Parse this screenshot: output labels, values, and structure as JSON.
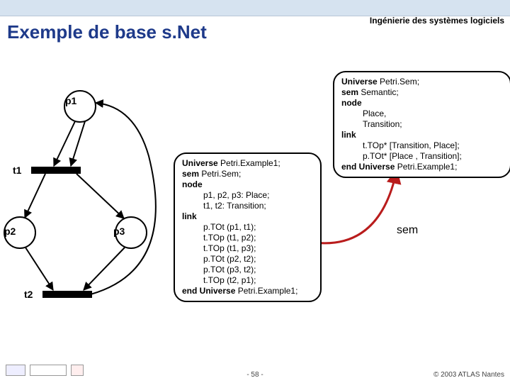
{
  "header": {
    "subject": "Ingénierie des systèmes logiciels",
    "title": "Exemple de base s.Net"
  },
  "petri": {
    "places": {
      "p1": "p1",
      "p2": "p2",
      "p3": "p3"
    },
    "transitions": {
      "t1": "t1",
      "t2": "t2"
    }
  },
  "code_example": {
    "l1_kw": "Universe",
    "l1_rest": " Petri.Example1;",
    "l2_kw": "sem",
    "l2_rest": " Petri.Sem;",
    "l3_kw": "node",
    "l4": "p1, p2, p3: Place;",
    "l5": "t1, t2: Transition;",
    "l6_kw": "link",
    "l7": "p.TOt (p1, t1);",
    "l8": "t.TOp (t1, p2);",
    "l9": "t.TOp (t1, p3);",
    "l10": "p.TOt (p2, t2);",
    "l11": "p.TOt (p3, t2);",
    "l12": "t.TOp (t2, p1);",
    "l13_kw": "end Universe",
    "l13_rest": " Petri.Example1;"
  },
  "code_sem": {
    "l1_kw": "Universe",
    "l1_rest": " Petri.Sem;",
    "l2_kw": "sem",
    "l2_rest": " Semantic;",
    "l3_kw": "node",
    "l4": "Place,",
    "l5": "Transition;",
    "l6_kw": "link",
    "l7": "t.TOp* [Transition, Place];",
    "l8": "p.TOt* [Place , Transition];",
    "l9_kw": "end Universe",
    "l9_rest": " Petri.Example1;"
  },
  "sem_label": "sem",
  "footer": {
    "page": "- 58 -",
    "copyright": "© 2003 ATLAS Nantes"
  }
}
